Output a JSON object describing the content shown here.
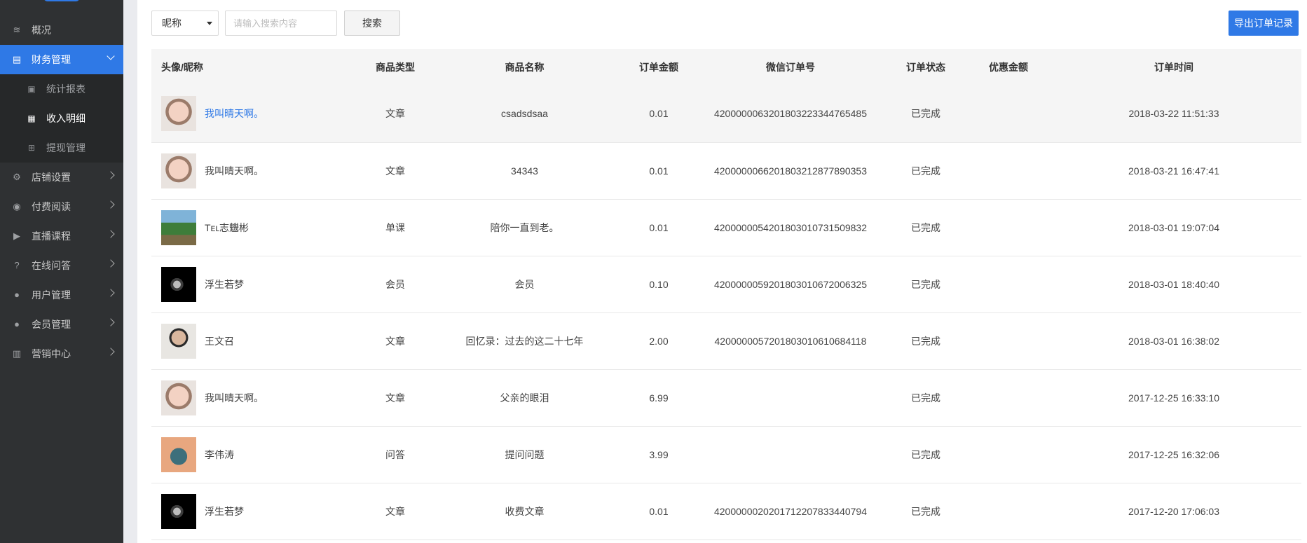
{
  "sidebar": {
    "items": [
      {
        "label": "概况",
        "icon": "layers-icon",
        "glyph": "≋"
      },
      {
        "label": "财务管理",
        "icon": "finance-icon",
        "glyph": "▤",
        "active": true
      },
      {
        "label": "店铺设置",
        "icon": "gear-icon",
        "glyph": "⚙"
      },
      {
        "label": "付费阅读",
        "icon": "paid-read-icon",
        "glyph": "◉"
      },
      {
        "label": "直播课程",
        "icon": "video-icon",
        "glyph": "▶"
      },
      {
        "label": "在线问答",
        "icon": "question-icon",
        "glyph": "?"
      },
      {
        "label": "用户管理",
        "icon": "user-icon",
        "glyph": "●"
      },
      {
        "label": "会员管理",
        "icon": "member-icon",
        "glyph": "●"
      },
      {
        "label": "营销中心",
        "icon": "chart-bar-icon",
        "glyph": "▥"
      }
    ],
    "submenu": [
      {
        "label": "统计报表",
        "icon": "clipboard-icon",
        "glyph": "▣"
      },
      {
        "label": "收入明细",
        "icon": "calendar-icon",
        "glyph": "▦",
        "current": true
      },
      {
        "label": "提现管理",
        "icon": "sitemap-icon",
        "glyph": "⊞"
      }
    ]
  },
  "toolbar": {
    "select_value": "昵称",
    "search_placeholder": "请输入搜索内容",
    "search_label": "搜索",
    "export_label": "导出订单记录"
  },
  "table": {
    "headers": [
      "头像/昵称",
      "商品类型",
      "商品名称",
      "订单金额",
      "微信订单号",
      "订单状态",
      "优惠金额",
      "订单时间"
    ],
    "rows": [
      {
        "avatar": "girl",
        "nick": "我叫晴天啊。",
        "type": "文章",
        "name": "csadsdsaa",
        "amount": "0.01",
        "wx_order": "4200000063201803223344765485",
        "status": "已完成",
        "discount": "",
        "time": "2018-03-22 11:51:33"
      },
      {
        "avatar": "girl",
        "nick": "我叫晴天啊。",
        "type": "文章",
        "name": "34343",
        "amount": "0.01",
        "wx_order": "4200000066201803212877890353",
        "status": "已完成",
        "discount": "",
        "time": "2018-03-21 16:47:41"
      },
      {
        "avatar": "landscape",
        "nick": "Tᴇʟ志魕彬",
        "type": "单课",
        "name": "陪你一直到老。",
        "amount": "0.01",
        "wx_order": "4200000054201803010731509832",
        "status": "已完成",
        "discount": "",
        "time": "2018-03-01 19:07:04"
      },
      {
        "avatar": "dark",
        "nick": "浮生若梦",
        "type": "会员",
        "name": "会员",
        "amount": "0.10",
        "wx_order": "4200000059201803010672006325",
        "status": "已完成",
        "discount": "",
        "time": "2018-03-01 18:40:40"
      },
      {
        "avatar": "man",
        "nick": "王文召",
        "type": "文章",
        "name": "回忆录：过去的这二十七年",
        "amount": "2.00",
        "wx_order": "4200000057201803010610684118",
        "status": "已完成",
        "discount": "",
        "time": "2018-03-01 16:38:02"
      },
      {
        "avatar": "girl",
        "nick": "我叫晴天啊。",
        "type": "文章",
        "name": "父亲的眼泪",
        "amount": "6.99",
        "wx_order": "",
        "status": "已完成",
        "discount": "",
        "time": "2017-12-25 16:33:10"
      },
      {
        "avatar": "kid",
        "nick": "李伟涛",
        "type": "问答",
        "name": "提问问题",
        "amount": "3.99",
        "wx_order": "",
        "status": "已完成",
        "discount": "",
        "time": "2017-12-25 16:32:06"
      },
      {
        "avatar": "dark",
        "nick": "浮生若梦",
        "type": "文章",
        "name": "收费文章",
        "amount": "0.01",
        "wx_order": "4200000020201712207833440794",
        "status": "已完成",
        "discount": "",
        "time": "2017-12-20 17:06:03"
      }
    ]
  },
  "colors": {
    "accent": "#2f79e6",
    "sidebar_bg": "#2f3133",
    "submenu_bg": "#262829"
  }
}
